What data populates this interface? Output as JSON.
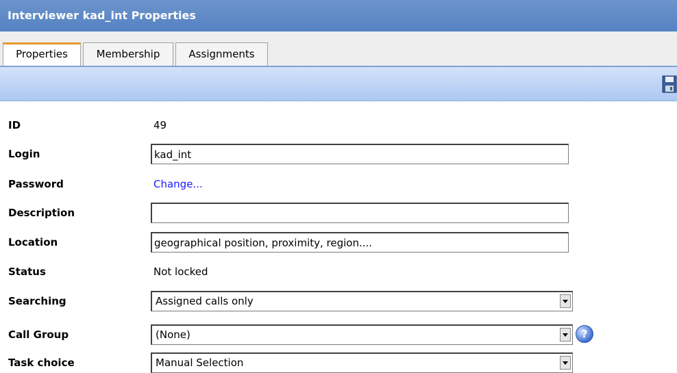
{
  "title": "Interviewer kad_int Properties",
  "tabs": [
    {
      "label": "Properties",
      "active": true
    },
    {
      "label": "Membership",
      "active": false
    },
    {
      "label": "Assignments",
      "active": false
    }
  ],
  "toolbar": {
    "save_icon": "save-icon"
  },
  "fields": {
    "id": {
      "label": "ID",
      "value": "49"
    },
    "login": {
      "label": "Login",
      "value": "kad_int"
    },
    "password": {
      "label": "Password",
      "link": "Change..."
    },
    "description": {
      "label": "Description",
      "value": ""
    },
    "location": {
      "label": "Location",
      "value": "geographical position, proximity, region...."
    },
    "status": {
      "label": "Status",
      "value": "Not locked"
    },
    "searching": {
      "label": "Searching",
      "value": "Assigned calls only"
    },
    "call_group": {
      "label": "Call Group",
      "value": "(None)",
      "help_icon": "help-icon"
    },
    "task_choice": {
      "label": "Task choice",
      "value": "Manual Selection"
    }
  },
  "colors": {
    "title_bar": "#5b87c6",
    "active_tab_accent": "#e89a2c",
    "toolbar": "#c0d6f7",
    "link": "#1a1aff"
  }
}
